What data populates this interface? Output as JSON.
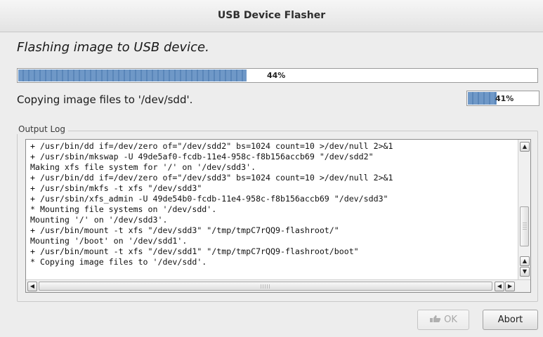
{
  "window": {
    "title": "USB Device Flasher"
  },
  "main": {
    "heading": "Flashing image to USB device.",
    "overall_progress": {
      "value": 44,
      "label": "44%"
    },
    "sub_status": "Copying image files to '/dev/sdd'.",
    "step_progress": {
      "value": 41,
      "label": "41%"
    }
  },
  "output_log": {
    "label": "Output Log",
    "lines": [
      "+ /usr/bin/dd if=/dev/zero of=\"/dev/sdd2\" bs=1024 count=10 >/dev/null 2>&1",
      "+ /usr/sbin/mkswap -U 49de5af0-fcdb-11e4-958c-f8b156accb69 \"/dev/sdd2\"",
      "Making xfs file system for '/' on '/dev/sdd3'.",
      "+ /usr/bin/dd if=/dev/zero of=\"/dev/sdd3\" bs=1024 count=10 >/dev/null 2>&1",
      "+ /usr/sbin/mkfs -t xfs \"/dev/sdd3\"",
      "+ /usr/sbin/xfs_admin -U 49de54b0-fcdb-11e4-958c-f8b156accb69 \"/dev/sdd3\"",
      "* Mounting file systems on '/dev/sdd'.",
      "Mounting '/' on '/dev/sdd3'.",
      "+ /usr/bin/mount -t xfs \"/dev/sdd3\" \"/tmp/tmpC7rQQ9-flashroot/\"",
      "Mounting '/boot' on '/dev/sdd1'.",
      "+ /usr/bin/mount -t xfs \"/dev/sdd1\" \"/tmp/tmpC7rQQ9-flashroot/boot\"",
      "* Copying image files to '/dev/sdd'."
    ]
  },
  "buttons": {
    "ok_label": "OK",
    "ok_enabled": false,
    "abort_label": "Abort"
  },
  "colors": {
    "progress_fill": "#6f98c7",
    "window_bg": "#ededed"
  },
  "icons": {
    "ok": "thumbs-up-icon",
    "scroll_up": "arrow-up-icon",
    "scroll_down": "arrow-down-icon",
    "scroll_left": "arrow-left-icon",
    "scroll_right": "arrow-right-icon"
  }
}
